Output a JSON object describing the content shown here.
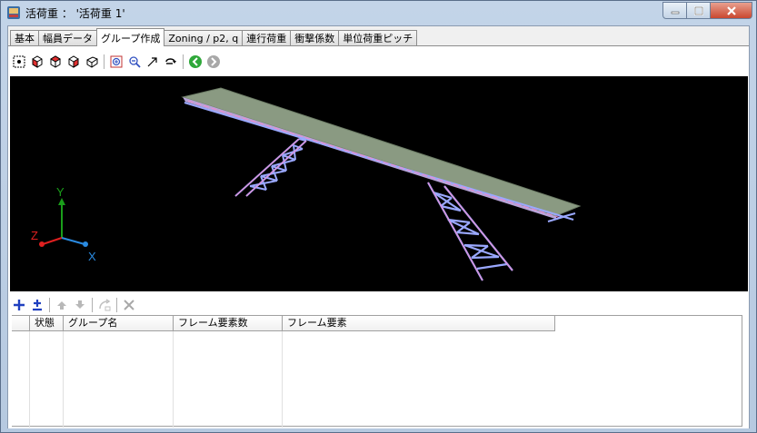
{
  "window": {
    "title": "活荷重 ： '活荷重 1'",
    "icon": "app-icon",
    "controls": [
      "minimize-icon",
      "maximize-icon",
      "close-icon"
    ]
  },
  "tabs": [
    {
      "label": "基本"
    },
    {
      "label": "幅員データ"
    },
    {
      "label": "グループ作成",
      "active": true
    },
    {
      "label": "Zoning / p2, q"
    },
    {
      "label": "連行荷重"
    },
    {
      "label": "衝撃係数"
    },
    {
      "label": "単位荷重ピッチ"
    }
  ],
  "toolbar_view": [
    "fit-all-icon",
    "cube-front-icon",
    "cube-top-icon",
    "cube-side-icon",
    "cube-iso-icon",
    "zoom-window-icon",
    "zoom-out-icon",
    "pan-arrow-icon",
    "rotate-icon",
    "go-forward-icon",
    "go-back-icon"
  ],
  "axes": {
    "y": "Y",
    "z": "Z",
    "x": "X",
    "y_color": "#1a9e1a",
    "z_color": "#e02020",
    "x_color": "#2a8ae0"
  },
  "colors": {
    "deck": "#8a9a82",
    "frame": "#9aa8ff",
    "frame_pink": "#f08ad0",
    "viewport_bg": "#000000"
  },
  "toolbar_group": [
    "add-icon",
    "add-remove-icon",
    "move-up-icon",
    "move-down-icon",
    "swap-icon",
    "delete-icon"
  ],
  "table": {
    "columns": [
      {
        "label": ""
      },
      {
        "label": "状態"
      },
      {
        "label": "グループ名"
      },
      {
        "label": "フレーム要素数"
      },
      {
        "label": "フレーム要素"
      }
    ],
    "rows": []
  }
}
